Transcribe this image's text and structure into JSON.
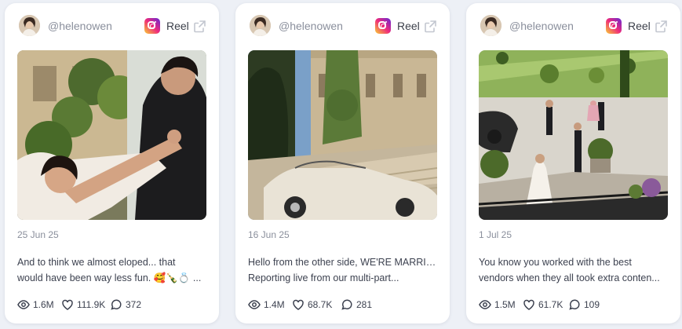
{
  "colors": {
    "background": "#edf0f6",
    "card": "#ffffff",
    "muted_text": "#8a8f9c",
    "body_text": "#3d4250"
  },
  "posts": [
    {
      "handle": "@helenowen",
      "platform_icon": "instagram-icon",
      "type_label": "Reel",
      "date": "25 Jun 25",
      "caption_line1": "And to think we almost eloped... that",
      "caption_line2": "would have been way less fun. 🥰🍾💍 ...",
      "views": "1.6M",
      "likes": "111.9K",
      "comments": "372"
    },
    {
      "handle": "@helenowen",
      "platform_icon": "instagram-icon",
      "type_label": "Reel",
      "date": "16 Jun 25",
      "caption_line1": "Hello from the other side, WE'RE MARRIED!",
      "caption_line2": "Reporting live from our multi-part...",
      "views": "1.4M",
      "likes": "68.7K",
      "comments": "281"
    },
    {
      "handle": "@helenowen",
      "platform_icon": "instagram-icon",
      "type_label": "Reel",
      "date": "1 Jul 25",
      "caption_line1": "You know you worked with the best",
      "caption_line2": "vendors when they all took extra conten...",
      "views": "1.5M",
      "likes": "61.7K",
      "comments": "109"
    }
  ]
}
